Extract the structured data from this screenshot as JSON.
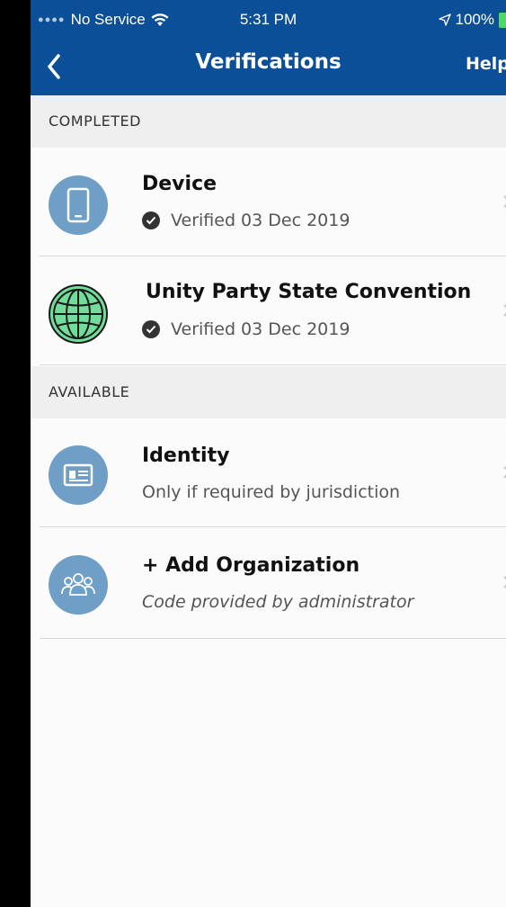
{
  "status_bar": {
    "carrier": "No Service",
    "time": "5:31 PM",
    "battery": "100%"
  },
  "nav": {
    "title": "Verifications",
    "help_label": "Help",
    "back_icon": "chevron-left-icon"
  },
  "sections": {
    "completed": {
      "header": "COMPLETED",
      "items": [
        {
          "title": "Device",
          "status": "Verified 03 Dec 2019",
          "icon": "phone-icon"
        },
        {
          "title": "Unity Party State Convention",
          "status": "Verified 03 Dec 2019",
          "icon": "globe-icon"
        }
      ]
    },
    "available": {
      "header": "AVAILABLE",
      "items": [
        {
          "title": "Identity",
          "subtitle": "Only if required by jurisdiction",
          "icon": "id-card-icon"
        },
        {
          "title": "+ Add Organization",
          "subtitle": "Code provided by administrator",
          "icon": "group-icon"
        }
      ]
    }
  },
  "colors": {
    "nav_background": "#0b4f98",
    "icon_blue": "#6f9ec7",
    "icon_green": "#72dc9a",
    "battery_green": "#4cd964"
  }
}
